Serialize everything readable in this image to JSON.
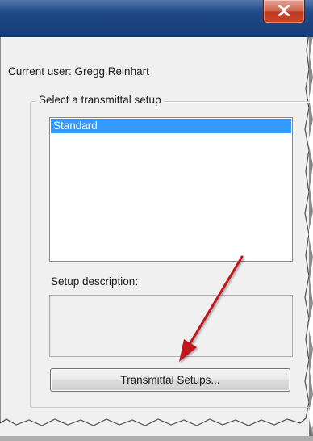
{
  "window": {
    "close_icon": "close-x-icon",
    "titlebar_color": "#1e4785",
    "close_button_color": "#c8472b"
  },
  "current_user": {
    "label": "Current user: Gregg.Reinhart"
  },
  "setup_group": {
    "legend": "Select a transmittal setup",
    "list_items": [
      {
        "label": "Standard",
        "selected": true
      }
    ],
    "selection_color": "#3399ff",
    "description_label": "Setup description:",
    "description_value": "",
    "transmittal_setups_button": "Transmittal Setups..."
  },
  "annotation": {
    "arrow_color": "#c0161c",
    "arrow_icon": "red-arrow-pointing-down-left"
  }
}
